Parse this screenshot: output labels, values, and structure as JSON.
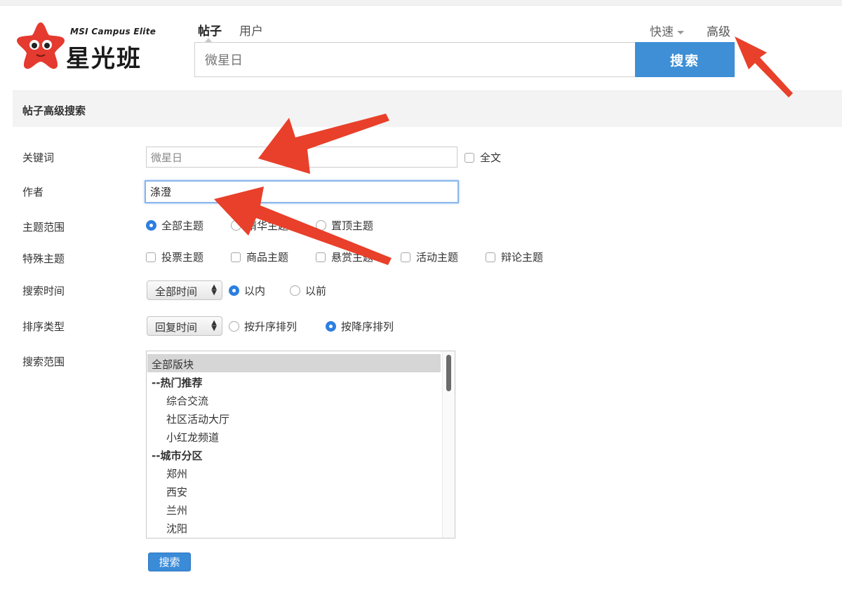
{
  "logo": {
    "en": "MSI Campus Elite",
    "cn": "星光班"
  },
  "search_tabs": {
    "posts": "帖子",
    "users": "用户"
  },
  "quick_label": "快速",
  "advanced_label": "高级",
  "main_search": {
    "value": "微星日",
    "button": "搜索"
  },
  "panel_title": "帖子高级搜索",
  "form": {
    "keyword_label": "关键词",
    "keyword_value": "微星日",
    "fulltext_label": "全文",
    "author_label": "作者",
    "author_value": "涤澄",
    "scope_label": "主题范围",
    "scope_options": [
      "全部主题",
      "精华主题",
      "置顶主题"
    ],
    "special_label": "特殊主题",
    "special_options": [
      "投票主题",
      "商品主题",
      "悬赏主题",
      "活动主题",
      "辩论主题"
    ],
    "time_label": "搜索时间",
    "time_select": "全部时间",
    "time_options": [
      "以内",
      "以前"
    ],
    "sort_label": "排序类型",
    "sort_select": "回复时间",
    "sort_options": [
      "按升序排列",
      "按降序排列"
    ],
    "range_label": "搜索范围",
    "forums": [
      "全部版块",
      "--热门推荐",
      "综合交流",
      "社区活动大厅",
      "小红龙频道",
      "--城市分区",
      "郑州",
      "西安",
      "兰州",
      "沈阳"
    ],
    "submit": "搜索"
  },
  "colors": {
    "accent": "#3e8fd6",
    "arrow": "#e8402a",
    "logo_red": "#e53a2f"
  }
}
